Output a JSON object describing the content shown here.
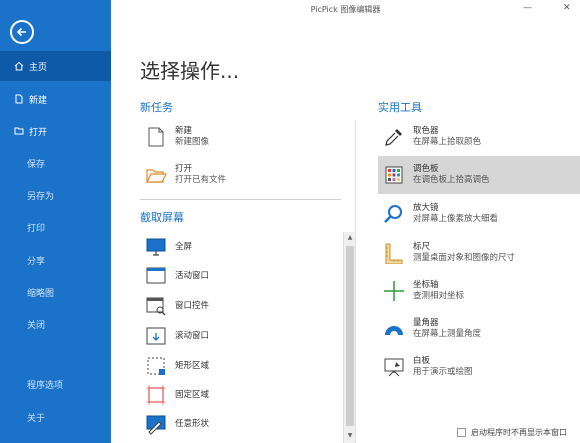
{
  "window": {
    "title": "PicPick 图像编辑器",
    "minimize": "—",
    "close": "✕"
  },
  "sidebar": {
    "items": [
      {
        "label": "主页",
        "icon": "home-icon"
      },
      {
        "label": "新建",
        "icon": "new-file-icon"
      },
      {
        "label": "打开",
        "icon": "open-folder-icon"
      },
      {
        "label": "保存"
      },
      {
        "label": "另存为"
      },
      {
        "label": "打印"
      },
      {
        "label": "分享"
      },
      {
        "label": "缩略图"
      },
      {
        "label": "关闭"
      },
      {
        "label": "程序选项"
      },
      {
        "label": "关于"
      }
    ]
  },
  "main": {
    "title": "选择操作...",
    "new_task": {
      "heading": "新任务",
      "items": [
        {
          "title": "新建",
          "subtitle": "新建图像",
          "icon": "blank-page-icon"
        },
        {
          "title": "打开",
          "subtitle": "打开已有文件",
          "icon": "open-folder-icon"
        }
      ]
    },
    "capture": {
      "heading": "截取屏幕",
      "items": [
        {
          "label": "全屏",
          "icon": "monitor-icon"
        },
        {
          "label": "活动窗口",
          "icon": "window-icon"
        },
        {
          "label": "窗口控件",
          "icon": "window-control-icon"
        },
        {
          "label": "滚动窗口",
          "icon": "scroll-window-icon"
        },
        {
          "label": "矩形区域",
          "icon": "rect-region-icon"
        },
        {
          "label": "固定区域",
          "icon": "fixed-region-icon"
        },
        {
          "label": "任意形状",
          "icon": "freehand-icon"
        }
      ]
    },
    "tools": {
      "heading": "实用工具",
      "items": [
        {
          "title": "取色器",
          "subtitle": "在屏幕上拾取颜色",
          "icon": "eyedropper-icon"
        },
        {
          "title": "调色板",
          "subtitle": "在调色板上拾高调色",
          "icon": "palette-icon"
        },
        {
          "title": "放大镜",
          "subtitle": "对屏幕上像素放大细看",
          "icon": "magnifier-icon"
        },
        {
          "title": "标尺",
          "subtitle": "测量桌面对象和图像的尺寸",
          "icon": "ruler-icon"
        },
        {
          "title": "坐标轴",
          "subtitle": "查测相对坐标",
          "icon": "crosshair-icon"
        },
        {
          "title": "量角器",
          "subtitle": "在屏幕上测量角度",
          "icon": "protractor-icon"
        },
        {
          "title": "白板",
          "subtitle": "用于演示或绘图",
          "icon": "whiteboard-icon"
        }
      ]
    },
    "footer_checkbox": "启动程序时不再显示本窗口"
  },
  "colors": {
    "sidebar": "#1a73c9",
    "sidebar_active": "#0f5aa8",
    "accent": "#1a73c9",
    "highlight": "#d6d6d6"
  }
}
